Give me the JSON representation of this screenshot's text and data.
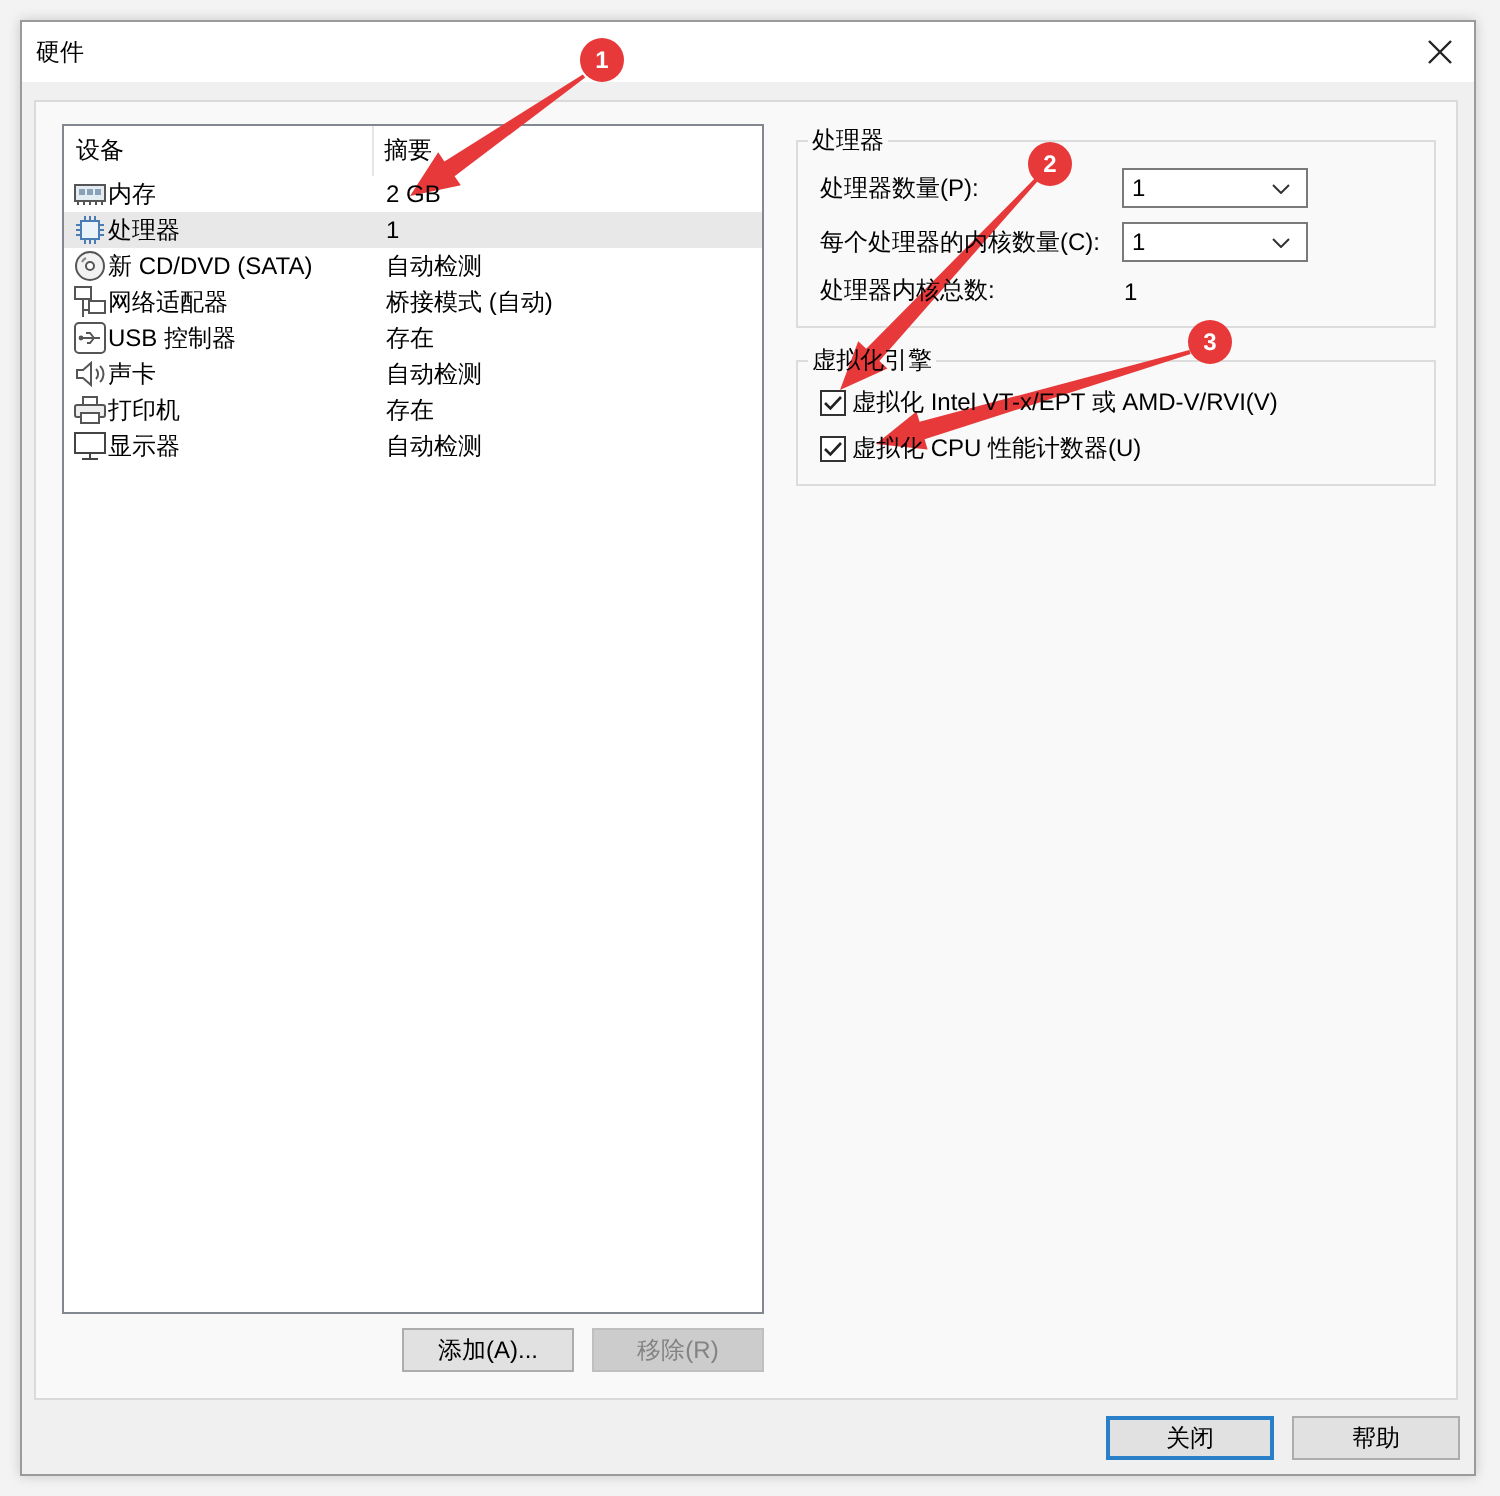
{
  "window": {
    "title": "硬件"
  },
  "device_list": {
    "columns": [
      "设备",
      "摘要"
    ],
    "rows": [
      {
        "kind": "memory",
        "device": "内存",
        "summary": "2 GB",
        "selected": false
      },
      {
        "kind": "processor",
        "device": "处理器",
        "summary": "1",
        "selected": true
      },
      {
        "kind": "disc",
        "device": "新 CD/DVD (SATA)",
        "summary": "自动检测",
        "selected": false
      },
      {
        "kind": "network",
        "device": "网络适配器",
        "summary": "桥接模式 (自动)",
        "selected": false
      },
      {
        "kind": "usb",
        "device": "USB 控制器",
        "summary": "存在",
        "selected": false
      },
      {
        "kind": "sound",
        "device": "声卡",
        "summary": "自动检测",
        "selected": false
      },
      {
        "kind": "printer",
        "device": "打印机",
        "summary": "存在",
        "selected": false
      },
      {
        "kind": "display",
        "device": "显示器",
        "summary": "自动检测",
        "selected": false
      }
    ]
  },
  "list_buttons": [
    {
      "label": "添加(A)...",
      "disabled": false
    },
    {
      "label": "移除(R)",
      "disabled": true
    }
  ],
  "processor_group": {
    "title": "处理器",
    "fields": [
      {
        "kind": "dropdown",
        "label": "处理器数量(P):",
        "value": "1"
      },
      {
        "kind": "dropdown",
        "label": "每个处理器的内核数量(C):",
        "value": "1"
      },
      {
        "kind": "readout",
        "label": "处理器内核总数:",
        "value": "1"
      }
    ]
  },
  "virtualization_group": {
    "title": "虚拟化引擎",
    "options": [
      {
        "label": "虚拟化 Intel VT-x/EPT 或 AMD-V/RVI(V)",
        "checked": true
      },
      {
        "label": "虚拟化 CPU 性能计数器(U)",
        "checked": true
      }
    ]
  },
  "annotations": [
    {
      "number": "1"
    },
    {
      "number": "2"
    },
    {
      "number": "3"
    }
  ],
  "footer_buttons": [
    {
      "label": "关闭",
      "default": true
    },
    {
      "label": "帮助",
      "default": false
    }
  ]
}
